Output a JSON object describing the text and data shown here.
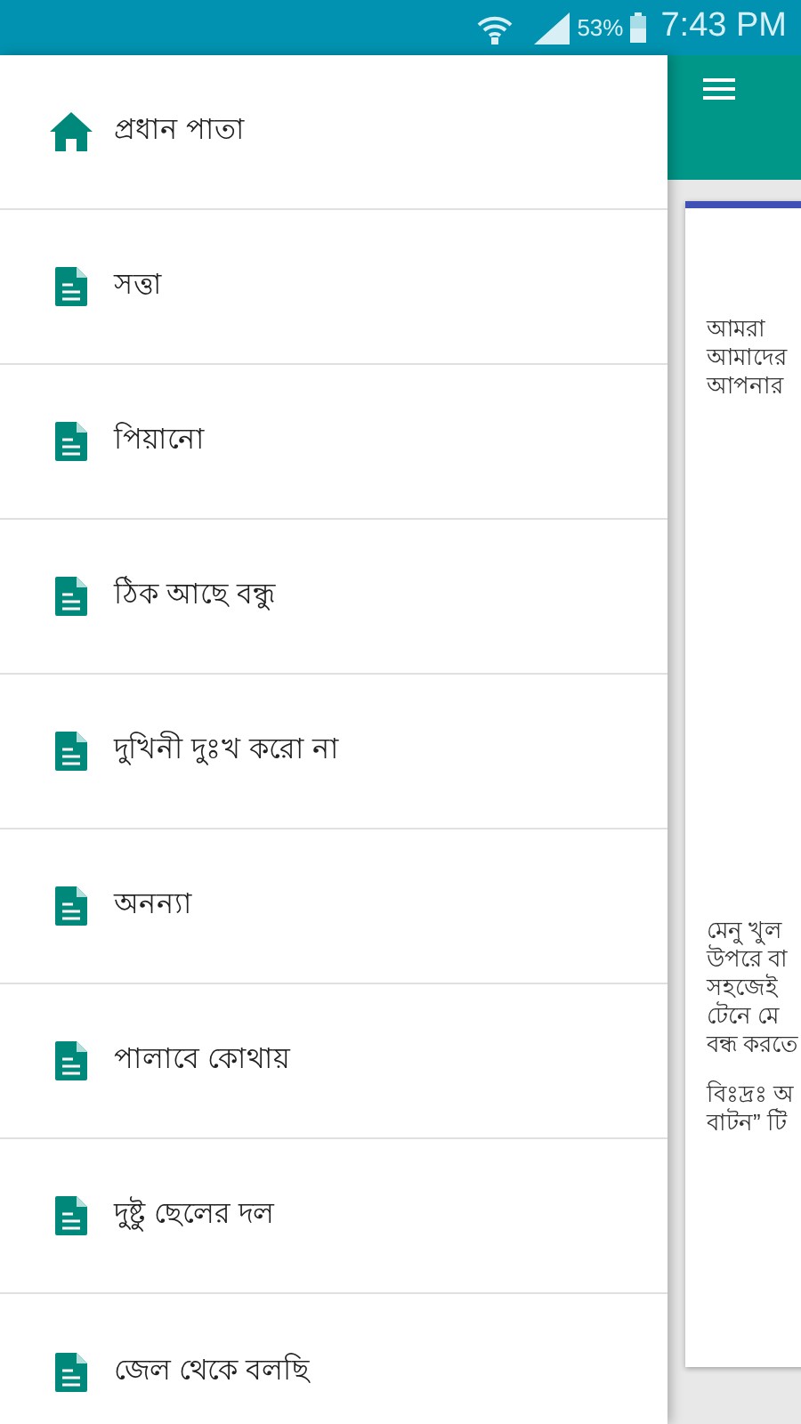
{
  "status_bar": {
    "battery": "53%",
    "time": "7:43 PM"
  },
  "drawer": {
    "items": [
      {
        "label": "প্রধান পাতা",
        "kind": "home"
      },
      {
        "label": "সত্তা",
        "kind": "page"
      },
      {
        "label": "পিয়ানো",
        "kind": "page"
      },
      {
        "label": "ঠিক আছে বন্ধু",
        "kind": "page"
      },
      {
        "label": "দুখিনী দুঃখ করো না",
        "kind": "page"
      },
      {
        "label": "অনন্যা",
        "kind": "page"
      },
      {
        "label": "পালাবে কোথায়",
        "kind": "page"
      },
      {
        "label": "দুষ্টু ছেলের দল",
        "kind": "page"
      },
      {
        "label": "জেল থেকে বলছি",
        "kind": "page"
      }
    ]
  },
  "content": {
    "paragraphs": [
      [
        "আমরা",
        "আমাদের",
        "আপনার"
      ],
      [
        "মেনু খুল",
        "উপরে বা",
        "সহজেই",
        "টেনে মে",
        "বন্ধ করতে"
      ],
      [
        "বিঃদ্রঃ অ",
        "বাটন” টি"
      ]
    ]
  }
}
